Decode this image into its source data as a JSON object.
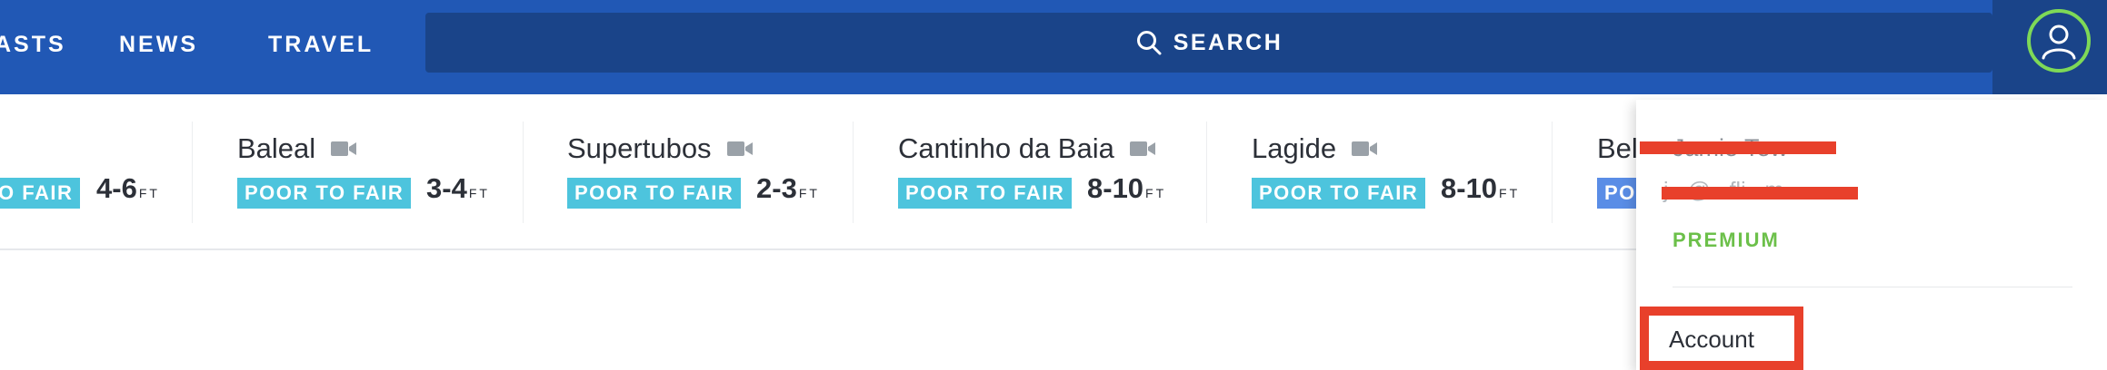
{
  "nav": {
    "items": [
      "ASTS",
      "NEWS",
      "TRAVEL"
    ],
    "search_label": "SEARCH"
  },
  "spots": [
    {
      "name": "",
      "condition": "O FAIR",
      "height": "4-6",
      "unit": "FT"
    },
    {
      "name": "Baleal",
      "condition": "POOR TO FAIR",
      "height": "3-4",
      "unit": "FT"
    },
    {
      "name": "Supertubos",
      "condition": "POOR TO FAIR",
      "height": "2-3",
      "unit": "FT"
    },
    {
      "name": "Cantinho da Baia",
      "condition": "POOR TO FAIR",
      "height": "8-10",
      "unit": "FT"
    },
    {
      "name": "Lagide",
      "condition": "POOR TO FAIR",
      "height": "8-10",
      "unit": "FT"
    },
    {
      "name": "Bel",
      "condition": "PO",
      "height": "",
      "unit": ""
    }
  ],
  "account_menu": {
    "name": "Jamie Tew",
    "email": "j...@...fli...m",
    "plan": "PREMIUM",
    "account_link": "Account"
  },
  "colors": {
    "nav_bg": "#2158b5",
    "search_bg": "#1a4489",
    "condition_badge": "#4dc4dd",
    "condition_badge_alt": "#5a8de6",
    "premium": "#6cc04a",
    "avatar_ring": "#7ed957",
    "annotation_red": "#e8402b"
  },
  "icons": {
    "search": "search-icon",
    "avatar": "user-icon",
    "camera": "camera-icon"
  }
}
